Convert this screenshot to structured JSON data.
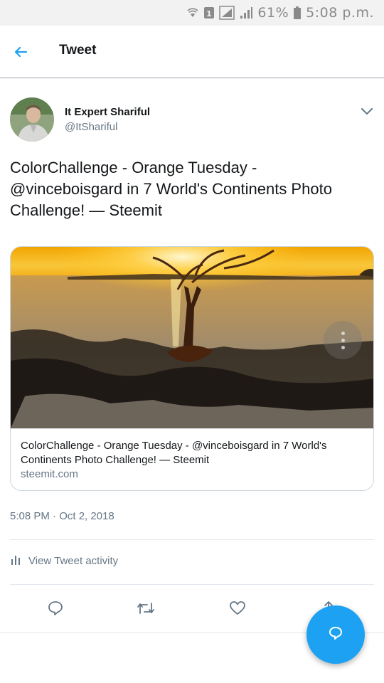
{
  "status_bar": {
    "battery": "61%",
    "time": "5:08 p.m.",
    "icons": [
      "wifi-icon",
      "sim-icon",
      "signal-icon",
      "signal-icon",
      "battery-icon"
    ]
  },
  "header": {
    "title": "Tweet",
    "back_icon": "arrow-left-icon"
  },
  "author": {
    "name": "It Expert Shariful",
    "handle": "@ItShariful",
    "menu_icon": "chevron-down-icon"
  },
  "tweet": {
    "text": "ColorChallenge - Orange Tuesday - @vinceboisgard in 7 World's Continents Photo Challenge! — Steemit",
    "timestamp": "5:08 PM · Oct 2, 2018"
  },
  "card": {
    "title": "ColorChallenge - Orange Tuesday - @vinceboisgard in 7 World's Continents Photo Challenge! — Steemit",
    "domain": "steemit.com",
    "image_subject": "orange sunset over water with silhouetted tree"
  },
  "activity": {
    "label": "View Tweet activity",
    "icon": "bar-chart-icon"
  },
  "actions": [
    "reply-icon",
    "retweet-icon",
    "like-icon",
    "share-icon"
  ],
  "colors": {
    "accent": "#1da1f2",
    "text": "#14171a",
    "secondary": "#657786",
    "border": "#e1e8ed"
  }
}
